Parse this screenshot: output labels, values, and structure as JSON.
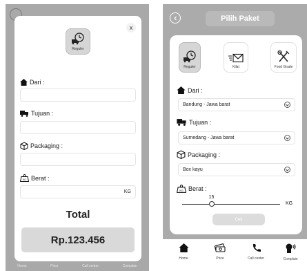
{
  "left": {
    "close": "x",
    "tile_label": "Reguler",
    "dari_label": "Dari :",
    "dari_value": "",
    "tujuan_label": "Tujuan :",
    "tujuan_value": "",
    "packaging_label": "Packaging :",
    "packaging_value": "",
    "berat_label": "Berat :",
    "berat_unit": "KG",
    "total_label": "Total",
    "price": "Rp.123.456",
    "nav": [
      "Home",
      "Price",
      "Call center",
      "Complain"
    ]
  },
  "right": {
    "title": "Pilih Paket",
    "tiles": [
      {
        "label": "Reguler",
        "selected": true
      },
      {
        "label": "Kilat",
        "selected": false
      },
      {
        "label": "Food Grade",
        "selected": false
      }
    ],
    "dari_label": "Dari :",
    "dari_value": "Bandung - Jawa barat",
    "tujuan_label": "Tujuan :",
    "tujuan_value": "Sumedang - Jawa barat",
    "packaging_label": "Packaging :",
    "packaging_value": "Box kayu",
    "berat_label": "Berat :",
    "berat_value": "15",
    "berat_unit": "KG",
    "berat_fraction": 0.3,
    "cek_label": "Cek",
    "nav": [
      "Home",
      "Price",
      "Call center",
      "Complain"
    ]
  },
  "icons": {
    "tile": "clock-truck-icon",
    "kilat": "fast-envelope-icon",
    "food": "fork-knife-icon",
    "dari": "house-icon",
    "tujuan": "truck-icon",
    "packaging": "box-icon",
    "berat": "weight-kg-icon"
  }
}
